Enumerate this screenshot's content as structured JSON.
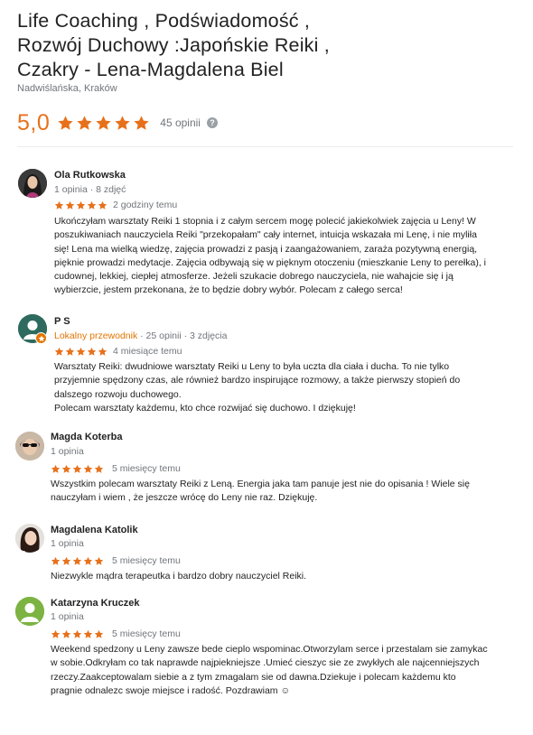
{
  "place": {
    "title": "Life Coaching , Podświadomość ,\nRozwój Duchowy :Japońskie Reiki ,\nCzakry - Lena-Magdalena Biel",
    "address": "Nadwiślańska, Kraków",
    "rating": "5,0",
    "stars": 5,
    "review_count_label": "45 opinii",
    "help_icon": "?"
  },
  "colors": {
    "star": "#e7711b",
    "rating": "#e7711b",
    "meta": "#70757a",
    "guide": "#e37400"
  },
  "reviews": [
    {
      "name": "Ola Rutkowska",
      "meta": "1 opinia · 8 zdjęć",
      "stars": 5,
      "date": "2 godziny temu",
      "text": "Ukończyłam warsztaty Reiki 1 stopnia i z całym sercem mogę polecić jakiekolwiek zajęcia u Leny! W\nposzukiwaniach nauczyciela Reiki \"przekopałam\" cały internet, intuicja wskazała mi Lenę, i nie myliła\nsię! Lena ma wielką wiedzę, zajęcia prowadzi z pasją i zaangażowaniem, zaraża pozytywną energią,\npięknie prowadzi medytacje. Zajęcia odbywają się w pięknym otoczeniu (mieszkanie Leny to perełka), i\ncudownej, lekkiej, ciepłej atmosferze. Jeżeli szukacie dobrego nauczyciela, nie wahajcie się i ją\nwybierzcie, jestem przekonana, że to będzie dobry wybór.  Polecam z całego serca!",
      "avatar_icon": "person-photo-icon"
    },
    {
      "name": "P S",
      "guide_label": "Lokalny przewodnik",
      "meta": " · 25 opinii · 3 zdjęcia",
      "stars": 5,
      "date": "4 miesiące temu",
      "text": "Warsztaty Reiki: dwudniowe warsztaty Reiki u Leny to była uczta dla ciała i ducha. To nie tylko\nprzyjemnie spędzony czas, ale również bardzo inspirujące rozmowy, a także pierwszy stopień do\ndalszego rozwoju duchowego.\nPolecam warsztaty każdemu, kto chce rozwijać się duchowo. I dziękuję!",
      "avatar_icon": "default-person-icon"
    },
    {
      "name": "Magda Koterba",
      "meta": "1 opinia",
      "stars": 5,
      "date": "5 miesięcy temu",
      "text": "Wszystkim polecam warsztaty Reiki z Leną. Energia jaka tam  panuje jest nie do opisania ! Wiele się\nnauczyłam i wiem , że jeszcze wrócę do Leny nie raz. Dziękuję.",
      "avatar_icon": "person-photo-icon"
    },
    {
      "name": "Magdalena Katolik",
      "meta": "1 opinia",
      "stars": 5,
      "date": "5 miesięcy temu",
      "text": "Niezwykle mądra terapeutka i bardzo dobry nauczyciel Reiki.",
      "avatar_icon": "person-photo-icon"
    },
    {
      "name": "Katarzyna Kruczek",
      "meta": "1 opinia",
      "stars": 5,
      "date": "5 miesięcy temu",
      "text": "Weekend spedzony u Leny zawsze bede cieplo wspominac.Otworzylam serce i przestalam sie zamykac\nw sobie.Odkryłam co tak naprawde najpiekniejsze .Umieć cieszyc sie ze zwykłych ale najcenniejszych\nrzeczy.Zaakceptowalam siebie a z tym zmagalam sie od dawna.Dziekuje i polecam każdemu kto\npragnie odnalezc swoje miejsce i radość. Pozdrawiam ☺",
      "avatar_icon": "default-person-icon"
    }
  ]
}
